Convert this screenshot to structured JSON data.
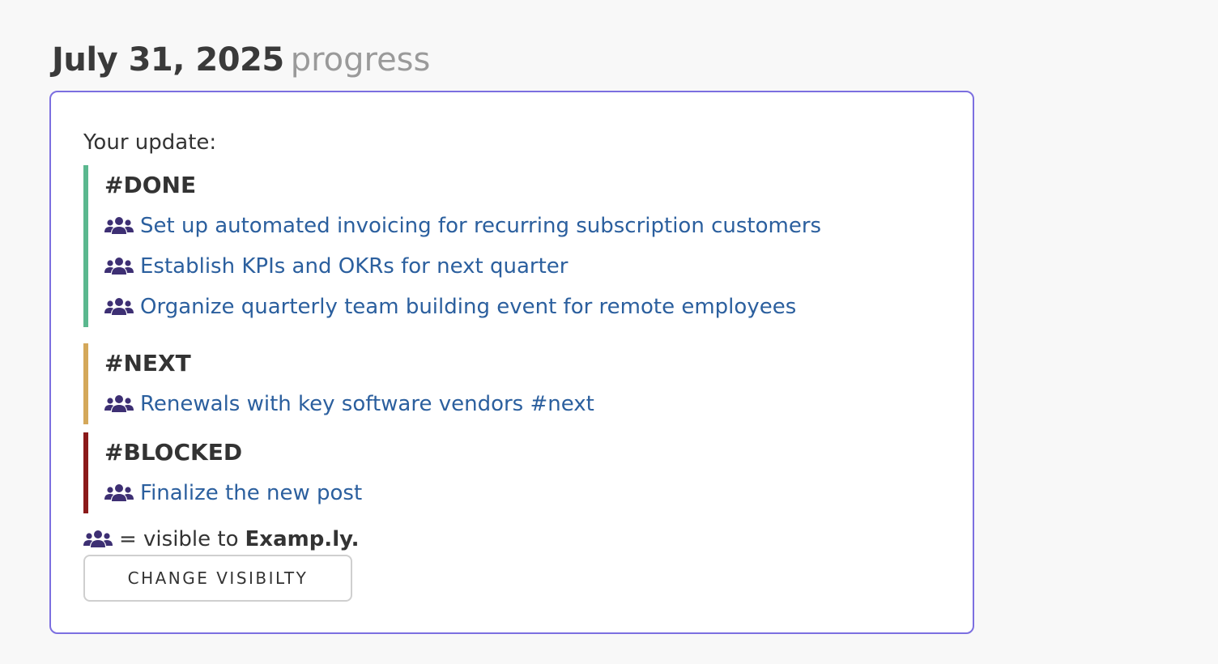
{
  "header": {
    "date": "July 31, 2025",
    "suffix": "progress"
  },
  "card": {
    "label": "Your update:",
    "sections": [
      {
        "title": "#DONE",
        "accent": "#5bb88f",
        "items": [
          {
            "text": "Set up automated invoicing for recurring subscription customers",
            "icon": "team-icon"
          },
          {
            "text": "Establish KPIs and OKRs for next quarter",
            "icon": "team-icon"
          },
          {
            "text": "Organize quarterly team building event for remote employees",
            "icon": "team-icon"
          }
        ]
      },
      {
        "title": "#NEXT",
        "accent": "#d4a85a",
        "items": [
          {
            "text": "Renewals with key software vendors #next",
            "icon": "team-icon"
          }
        ]
      },
      {
        "title": "#BLOCKED",
        "accent": "#8b1a1a",
        "items": [
          {
            "text": "Finalize the new post",
            "icon": "team-icon"
          }
        ]
      }
    ],
    "legend": {
      "icon": "team-icon",
      "text": "= visible to",
      "org": "Examp.ly."
    },
    "button_label": "CHANGE VISIBILTY"
  },
  "colors": {
    "card_border": "#7c6fe0",
    "link": "#2b5f9e",
    "icon": "#3d2f73"
  }
}
